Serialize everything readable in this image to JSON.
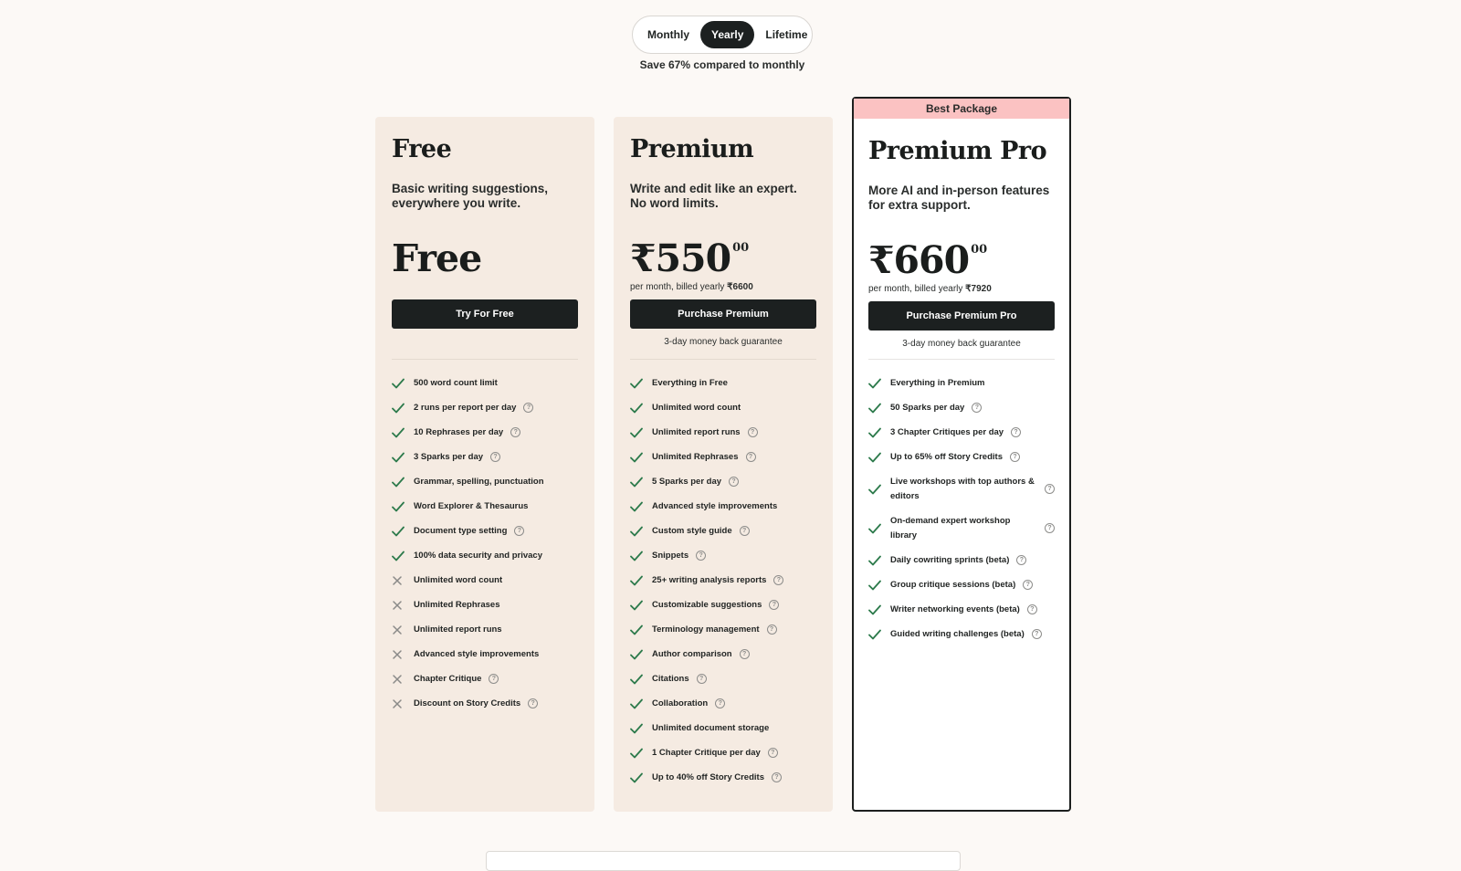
{
  "billing_toggle": {
    "options": [
      "Monthly",
      "Yearly",
      "Lifetime"
    ],
    "selected": "Yearly",
    "save_note": "Save 67% compared to monthly"
  },
  "colors": {
    "background": "#fcf9f6",
    "card_background": "#f5ebe2",
    "dark": "#1c2020",
    "check": "#2c7a4b",
    "cross": "#8a8a88",
    "ribbon": "#fbc2c2"
  },
  "plans": [
    {
      "name": "Free",
      "description": "Basic writing suggestions, everywhere you write.",
      "price_main": "Free",
      "price_cents": "",
      "billing_prefix": "",
      "billing_amount": "",
      "cta": "Try For Free",
      "guarantee": "",
      "features": [
        {
          "text": "500 word count limit",
          "included": true,
          "info": false
        },
        {
          "text": "2 runs per report per day",
          "included": true,
          "info": true
        },
        {
          "text": "10 Rephrases per day",
          "included": true,
          "info": true
        },
        {
          "text": "3 Sparks per day",
          "included": true,
          "info": true
        },
        {
          "text": "Grammar, spelling, punctuation",
          "included": true,
          "info": false
        },
        {
          "text": "Word Explorer & Thesaurus",
          "included": true,
          "info": false
        },
        {
          "text": "Document type setting",
          "included": true,
          "info": true
        },
        {
          "text": "100% data security and privacy",
          "included": true,
          "info": false
        },
        {
          "text": "Unlimited word count",
          "included": false,
          "info": false
        },
        {
          "text": "Unlimited Rephrases",
          "included": false,
          "info": false
        },
        {
          "text": "Unlimited report runs",
          "included": false,
          "info": false
        },
        {
          "text": "Advanced style improvements",
          "included": false,
          "info": false
        },
        {
          "text": "Chapter Critique",
          "included": false,
          "info": true
        },
        {
          "text": "Discount on Story Credits",
          "included": false,
          "info": true
        }
      ]
    },
    {
      "name": "Premium",
      "description": "Write and edit like an expert. No word limits.",
      "price_main": "₹550",
      "price_cents": "00",
      "billing_prefix": "per month, billed yearly",
      "billing_amount": "₹6600",
      "cta": "Purchase Premium",
      "guarantee": "3-day money back guarantee",
      "features": [
        {
          "text": "Everything in Free",
          "included": true,
          "info": false
        },
        {
          "text": "Unlimited word count",
          "included": true,
          "info": false
        },
        {
          "text": "Unlimited report runs",
          "included": true,
          "info": true
        },
        {
          "text": "Unlimited Rephrases",
          "included": true,
          "info": true
        },
        {
          "text": "5 Sparks per day",
          "included": true,
          "info": true
        },
        {
          "text": "Advanced style improvements",
          "included": true,
          "info": false
        },
        {
          "text": "Custom style guide",
          "included": true,
          "info": true
        },
        {
          "text": "Snippets",
          "included": true,
          "info": true
        },
        {
          "text": "25+ writing analysis reports",
          "included": true,
          "info": true
        },
        {
          "text": "Customizable suggestions",
          "included": true,
          "info": true
        },
        {
          "text": "Terminology management",
          "included": true,
          "info": true
        },
        {
          "text": "Author comparison",
          "included": true,
          "info": true
        },
        {
          "text": "Citations",
          "included": true,
          "info": true
        },
        {
          "text": "Collaboration",
          "included": true,
          "info": true
        },
        {
          "text": "Unlimited document storage",
          "included": true,
          "info": false
        },
        {
          "text": "1 Chapter Critique per day",
          "included": true,
          "info": true
        },
        {
          "text": "Up to 40% off Story Credits",
          "included": true,
          "info": true
        }
      ]
    },
    {
      "name": "Premium Pro",
      "ribbon": "Best Package",
      "description": "More AI and in-person features for extra support.",
      "price_main": "₹660",
      "price_cents": "00",
      "billing_prefix": "per month, billed yearly",
      "billing_amount": "₹7920",
      "cta": "Purchase Premium Pro",
      "guarantee": "3-day money back guarantee",
      "features": [
        {
          "text": "Everything in Premium",
          "included": true,
          "info": false
        },
        {
          "text": "50 Sparks per day",
          "included": true,
          "info": true
        },
        {
          "text": "3 Chapter Critiques per day",
          "included": true,
          "info": true
        },
        {
          "text": "Up to 65% off Story Credits",
          "included": true,
          "info": true
        },
        {
          "text": "Live workshops with top authors & editors",
          "included": true,
          "info": true
        },
        {
          "text": "On-demand expert workshop library",
          "included": true,
          "info": true
        },
        {
          "text": "Daily cowriting sprints (beta)",
          "included": true,
          "info": true
        },
        {
          "text": "Group critique sessions (beta)",
          "included": true,
          "info": true
        },
        {
          "text": "Writer networking events (beta)",
          "included": true,
          "info": true
        },
        {
          "text": "Guided writing challenges (beta)",
          "included": true,
          "info": true
        }
      ]
    }
  ]
}
